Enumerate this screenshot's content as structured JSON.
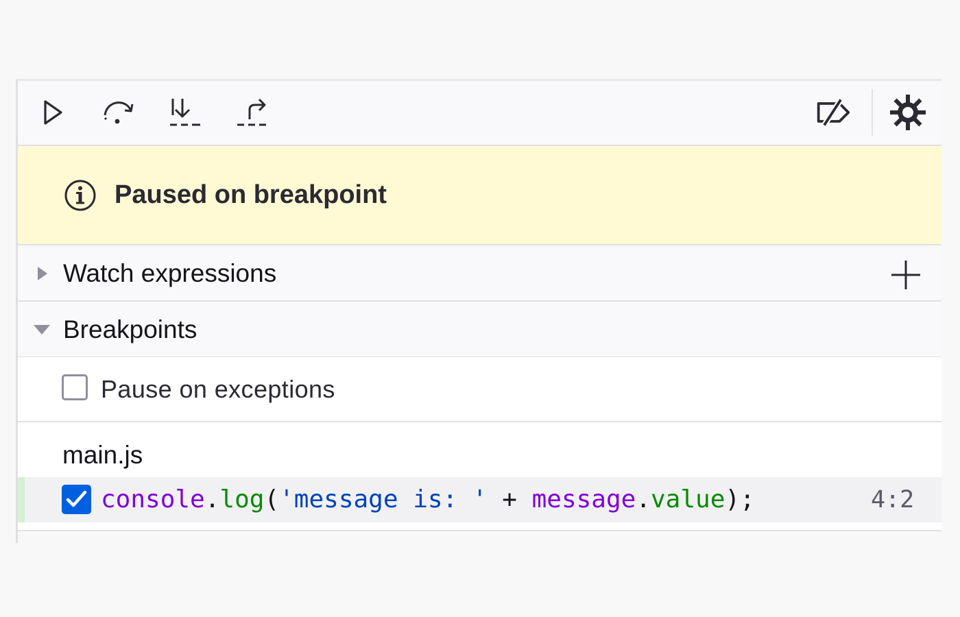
{
  "toolbar": {
    "buttons": [
      {
        "name": "resume",
        "icon": "play-icon"
      },
      {
        "name": "step-over",
        "icon": "step-over-icon"
      },
      {
        "name": "step-in",
        "icon": "step-in-icon"
      },
      {
        "name": "step-out",
        "icon": "step-out-icon"
      }
    ],
    "right_buttons": [
      {
        "name": "deactivate-breakpoints",
        "icon": "breakpoints-disabled-icon"
      },
      {
        "name": "settings",
        "icon": "gear-icon"
      }
    ]
  },
  "banner": {
    "text": "Paused on breakpoint",
    "icon": "info-icon",
    "background": "#fff9d4"
  },
  "watch": {
    "label": "Watch expressions",
    "expanded": false,
    "add_icon": "plus-icon"
  },
  "breakpoints": {
    "label": "Breakpoints",
    "expanded": true,
    "pause_on_exceptions": {
      "label": "Pause on exceptions",
      "checked": false
    },
    "files": [
      {
        "name": "main.js",
        "items": [
          {
            "checked": true,
            "code_tokens": {
              "t1": "console",
              "t2": ".",
              "t3": "log",
              "t4": "(",
              "t5": "'message is: '",
              "t6": " + ",
              "t7": "message",
              "t8": ".",
              "t9": "value",
              "t10": ");"
            },
            "location": "4:2"
          }
        ]
      }
    ]
  },
  "colors": {
    "accent": "#0060df",
    "keyword_purple": "#8000d7",
    "method_green": "#058b00",
    "string_blue": "#0043b8",
    "active_marker": "#d6f0d3"
  }
}
